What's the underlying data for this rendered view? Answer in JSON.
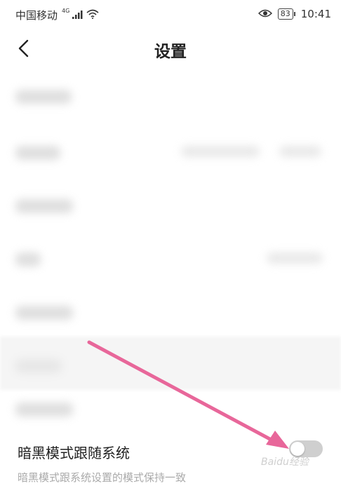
{
  "status_bar": {
    "carrier": "中国移动",
    "network": "4G",
    "battery": "83",
    "time": "10:41"
  },
  "header": {
    "title": "设置",
    "back_icon": "chevron-left-icon"
  },
  "dark_mode": {
    "title": "暗黑模式跟随系统",
    "description": "暗黑模式跟系统设置的模式保持一致",
    "enabled": false
  },
  "watermark": "Baidu经验",
  "colors": {
    "arrow": "#e8679a",
    "toggle_off": "#cfcfcf"
  }
}
